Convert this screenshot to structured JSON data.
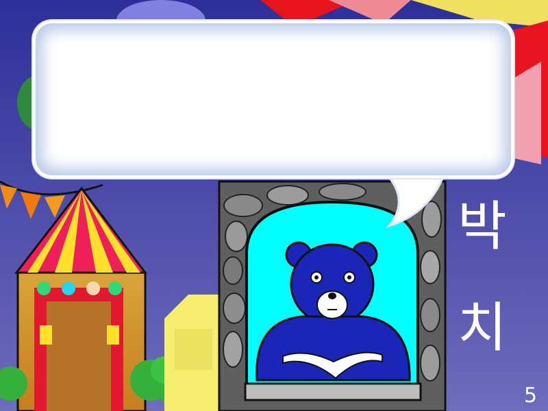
{
  "scene": {
    "colors": {
      "sky_top": "#2f2f9c",
      "sky_bottom": "#6a68b8",
      "tower_stone": "#5e5e5e",
      "window_glow": "#00ffff",
      "bear": "#1b25b8",
      "tent_red": "#e8184a",
      "tent_yellow": "#ffe02a",
      "bush": "#33b23b",
      "building_yellow": "#f3e86a"
    }
  },
  "dialog": {
    "text": ""
  },
  "side_title": {
    "char1": "박",
    "char2": "치"
  },
  "page": {
    "number": "5"
  }
}
